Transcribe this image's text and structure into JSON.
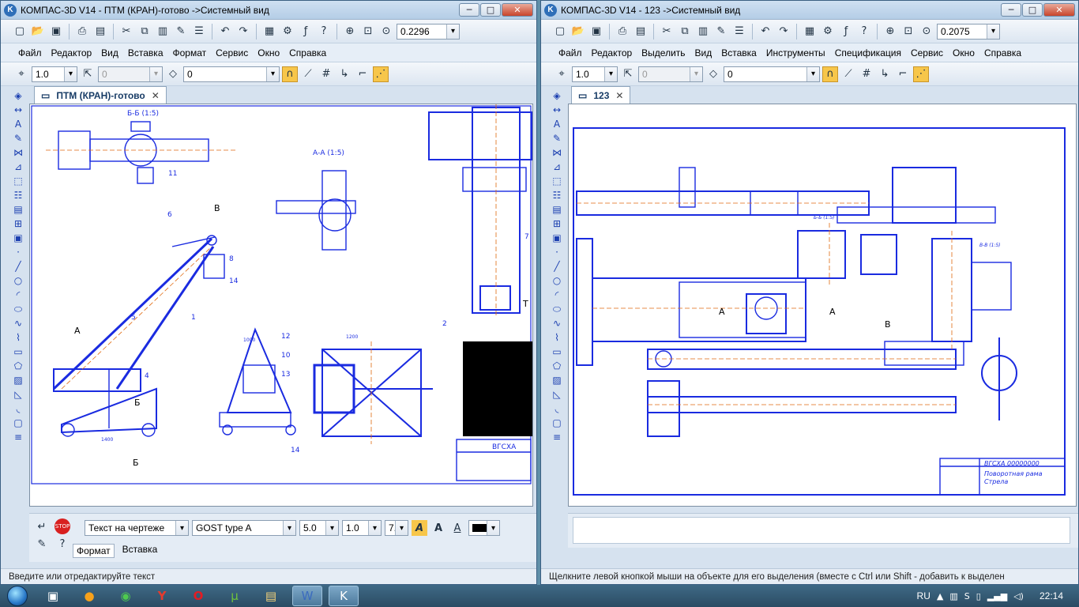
{
  "left_window": {
    "title": "КОМПАС-3D V14 - ПТМ (КРАН)-готово ->Системный вид",
    "zoom": "0.2296",
    "menu": [
      "Файл",
      "Редактор",
      "Вид",
      "Вставка",
      "Формат",
      "Сервис",
      "Окно",
      "Справка"
    ],
    "line_step": "1.0",
    "layer_combo": "0",
    "view_combo": "0",
    "doc_tab": "ПТМ (КРАН)-готово",
    "text_style": "Текст на чертеже",
    "font": "GOST type A",
    "font_size": "5.0",
    "line_spacing": "1.0",
    "char_width": "7.0",
    "prop_tabs": [
      "Формат",
      "Вставка"
    ],
    "status": "Введите или отредактируйте текст",
    "drawing_labels": [
      "Б-Б (1:5)",
      "А-А (1:5)",
      "В",
      "6",
      "8",
      "14",
      "5",
      "1",
      "А",
      "4",
      "Б",
      "Б",
      "12",
      "10",
      "13",
      "2",
      "14",
      "11",
      "ВГСХА",
      "7",
      "Т",
      "1400",
      "1200",
      "1000"
    ]
  },
  "right_window": {
    "title": "КОМПАС-3D V14 - 123 ->Системный вид",
    "zoom": "0.2075",
    "menu": [
      "Файл",
      "Редактор",
      "Выделить",
      "Вид",
      "Вставка",
      "Инструменты",
      "Спецификация",
      "Сервис",
      "Окно",
      "Справка"
    ],
    "line_step": "1.0",
    "layer_combo": "0",
    "view_combo": "0",
    "doc_tab": "123",
    "status": "Щелкните левой кнопкой мыши на объекте для его выделения (вместе с Ctrl или Shift - добавить к выделен",
    "drawing_labels": [
      "А",
      "А",
      "В",
      "ВГСХА 00000000",
      "Поворотная рама",
      "Стрела",
      "Б-Б (1:5)",
      "В-В (1:5)"
    ]
  },
  "window_buttons": {
    "min": "─",
    "max": "□",
    "close": "✕"
  },
  "taskbar": {
    "lang": "RU",
    "time": "22:14",
    "apps": [
      "media-player-icon",
      "avast-icon",
      "speedfan-icon",
      "yandex-icon",
      "opera-icon",
      "utorrent-icon",
      "explorer-icon",
      "word-icon",
      "kompas-icon"
    ]
  },
  "colors": {
    "drawing_blue": "#1a2be0",
    "axis_orange": "#e06a10",
    "titlebar": "#c2d8ee"
  }
}
